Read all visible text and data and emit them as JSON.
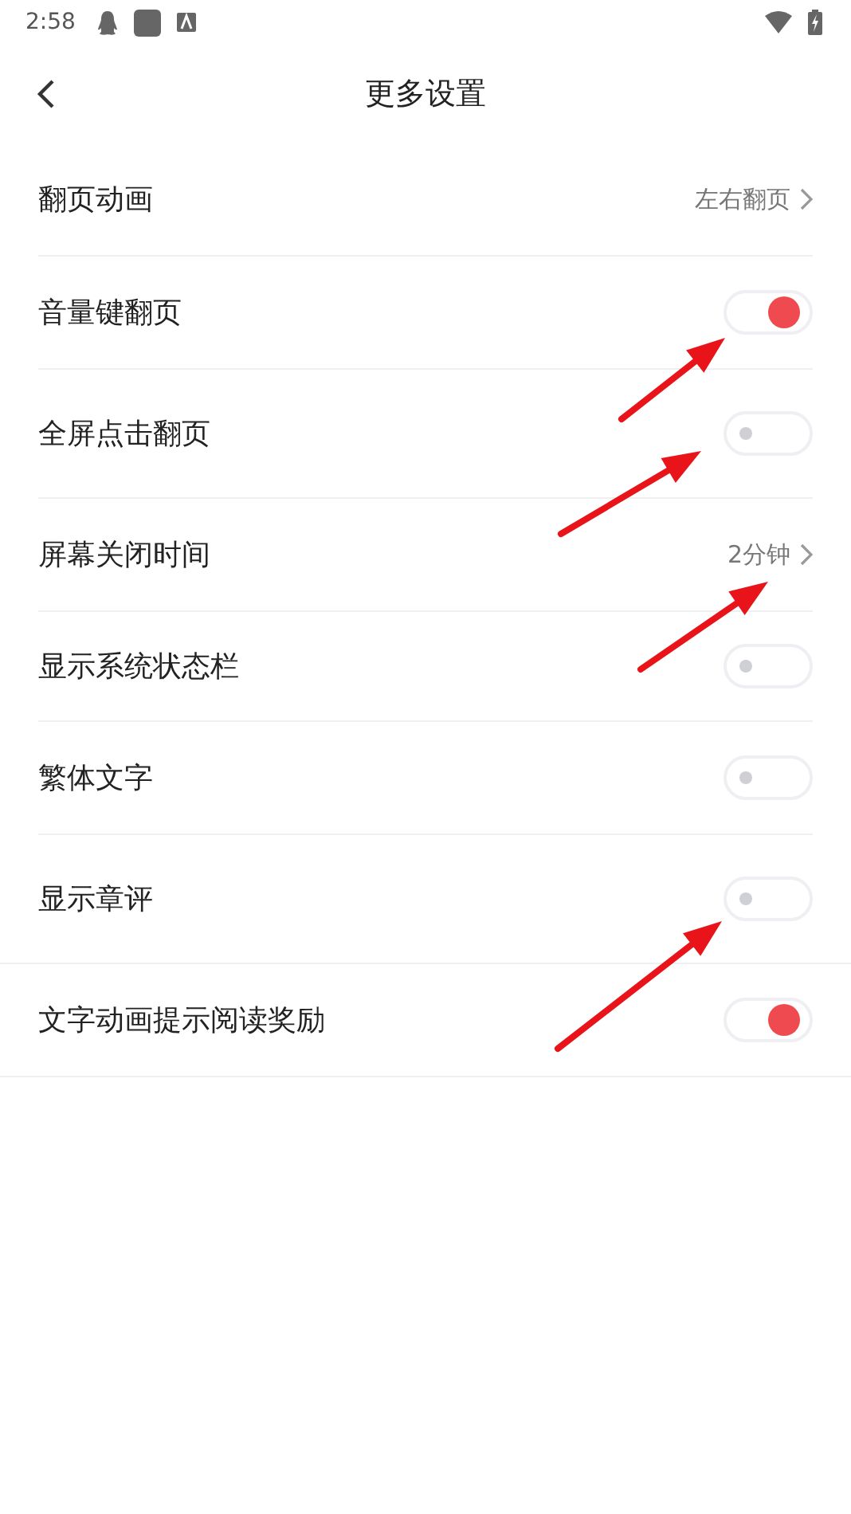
{
  "status_bar": {
    "time": "2:58"
  },
  "header": {
    "title": "更多设置"
  },
  "settings": [
    {
      "label": "翻页动画",
      "kind": "link",
      "value": "左右翻页"
    },
    {
      "label": "音量键翻页",
      "kind": "toggle",
      "on": true
    },
    {
      "label": "全屏点击翻页",
      "kind": "toggle",
      "on": false
    },
    {
      "label": "屏幕关闭时间",
      "kind": "link",
      "value": "2分钟"
    },
    {
      "label": "显示系统状态栏",
      "kind": "toggle",
      "on": false
    },
    {
      "label": "繁体文字",
      "kind": "toggle",
      "on": false
    },
    {
      "label": "显示章评",
      "kind": "toggle",
      "on": false
    },
    {
      "label": "文字动画提示阅读奖励",
      "kind": "toggle",
      "on": true
    }
  ]
}
